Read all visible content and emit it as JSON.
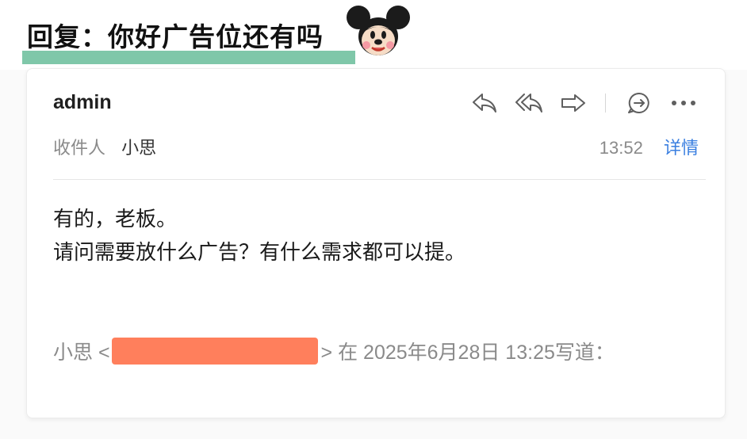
{
  "header": {
    "title": "回复：你好广告位还有吗",
    "mascot_icon": "mickey-mouse-sticker",
    "underline_color": "#7fc7a9"
  },
  "email": {
    "sender": "admin",
    "recipient_label": "收件人",
    "recipient_name": "小思",
    "time": "13:52",
    "details_label": "详情",
    "body_lines": [
      "有的，老板。",
      "请问需要放什么广告？有什么需求都可以提。"
    ],
    "quote_name_prefix": "小思 <",
    "quote_suffix": "> 在 2025年6月28日 13:25写道：",
    "redaction_color": "#ff7f5c"
  },
  "toolbar": {
    "icons": [
      "reply-icon",
      "reply-all-icon",
      "forward-icon",
      "comment-icon",
      "more-icon"
    ]
  },
  "colors": {
    "link": "#3a7fe0",
    "muted": "#8a8a8a"
  }
}
